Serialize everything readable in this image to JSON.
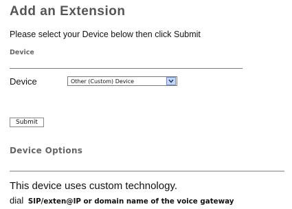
{
  "page": {
    "title": "Add an Extension",
    "intro": "Please select your Device below then click Submit"
  },
  "device_section": {
    "heading": "Device",
    "device_label": "Device",
    "device_select": {
      "selected": "Other (Custom) Device"
    }
  },
  "submit": {
    "label": "Submit"
  },
  "options_section": {
    "heading": "Device Options",
    "description": "This device uses custom technology.",
    "dial_label": "dial",
    "dial_value": "SIP/exten@IP or domain name of the voice gateway"
  }
}
